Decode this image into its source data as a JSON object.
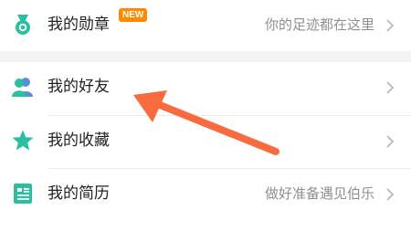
{
  "colors": {
    "badge": "#ff8a00",
    "annotation_arrow": "#f76b3e",
    "icon_teal": "#2bbfa0",
    "icon_blue": "#5a8fd8"
  },
  "menu": {
    "medals": {
      "label": "我的勋章",
      "badge": "NEW",
      "subtitle": "你的足迹都在这里",
      "icon": "medal-icon"
    },
    "friends": {
      "label": "我的好友",
      "icon": "friends-icon"
    },
    "favorites": {
      "label": "我的收藏",
      "icon": "star-icon"
    },
    "resume": {
      "label": "我的简历",
      "subtitle": "做好准备遇见伯乐",
      "icon": "resume-icon"
    }
  }
}
